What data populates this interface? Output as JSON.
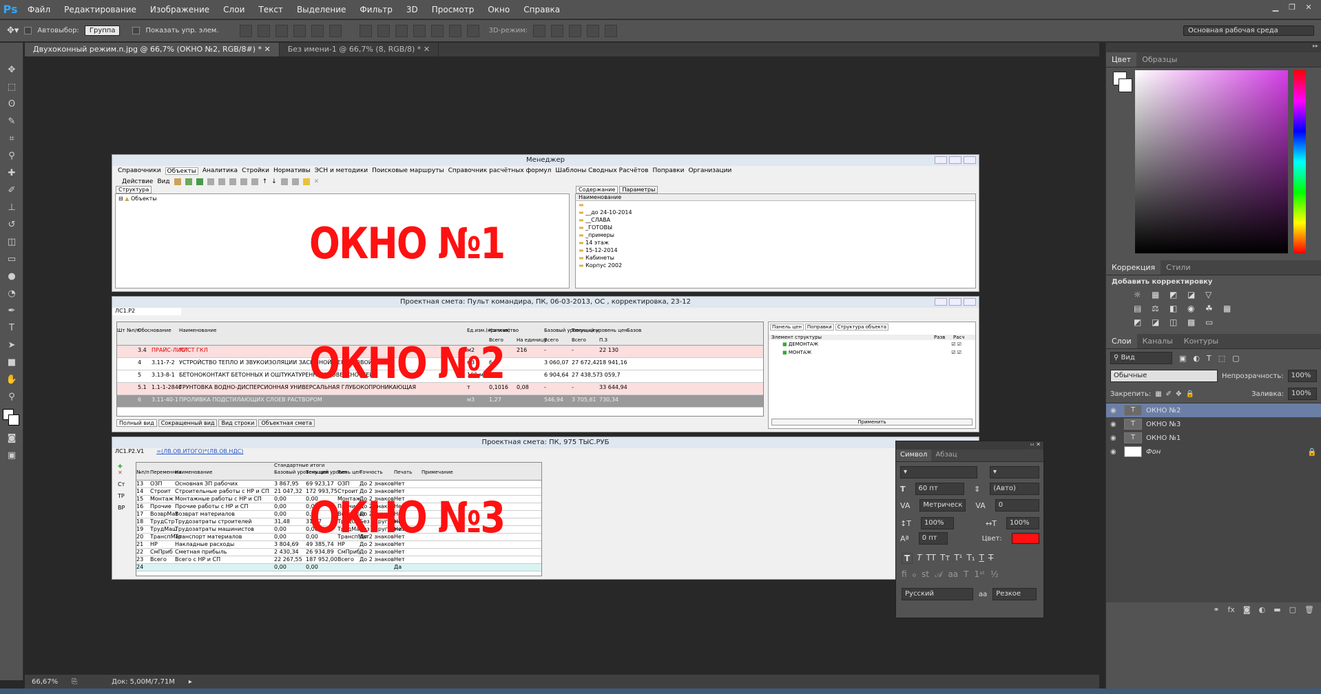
{
  "app": {
    "menu": [
      "Файл",
      "Редактирование",
      "Изображение",
      "Слои",
      "Текст",
      "Выделение",
      "Фильтр",
      "3D",
      "Просмотр",
      "Окно",
      "Справка"
    ]
  },
  "options": {
    "autoselect": "Автовыбор:",
    "group": "Группа",
    "show_controls": "Показать упр. элем.",
    "mode3d": "3D-режим:",
    "workspace": "Основная рабочая среда"
  },
  "tabs": [
    {
      "label": "Двухоконный режим.n.jpg @ 66,7% (ОКНО №2, RGB/8#) *"
    },
    {
      "label": "Без имени-1 @ 66,7% (8, RGB/8) *"
    }
  ],
  "status": {
    "zoom": "66,67%",
    "doc": "Док: 5,00M/7,71M"
  },
  "panels": {
    "color_tab": "Цвет",
    "swatches_tab": "Образцы",
    "adjust_tab": "Коррекция",
    "styles_tab": "Стили",
    "add_adjust": "Добавить корректировку",
    "layers_tab": "Слои",
    "channels_tab": "Каналы",
    "paths_tab": "Контуры",
    "kind": "Вид",
    "blend": "Обычные",
    "opacity_label": "Непрозрачность:",
    "opacity": "100%",
    "lock_label": "Закрепить:",
    "fill_label": "Заливка:",
    "fill": "100%"
  },
  "layers": [
    {
      "name": "ОКНО №2",
      "icon": "T"
    },
    {
      "name": "ОКНО №3",
      "icon": "T"
    },
    {
      "name": "ОКНО №1",
      "icon": "T"
    },
    {
      "name": "Фон",
      "icon": ""
    }
  ],
  "symbol": {
    "tab1": "Символ",
    "tab2": "Абзац",
    "size": "60 пт",
    "lead": "(Авто)",
    "kern": "Метрическ",
    "track": "0",
    "vscale": "100%",
    "hscale": "100%",
    "baseline": "0 пт",
    "color_label": "Цвет:",
    "lang": "Русский",
    "aa_label": "аа",
    "aa": "Резкое",
    "color": "#ff1111"
  },
  "win1": {
    "title": "Менеджер",
    "menu": [
      "Справочники",
      "Объекты",
      "Аналитика",
      "Стройки",
      "Нормативы",
      "ЭСН и методики",
      "Поисковые маршруты",
      "Справочник расчётных формул",
      "Шаблоны Сводных Расчётов",
      "Поправки",
      "Организации"
    ],
    "actions": [
      "Действие",
      "Вид"
    ],
    "left_tab": "Структура",
    "tree_root": "Объекты",
    "right_tabs": [
      "Содержание",
      "Параметры"
    ],
    "col": "Наименование",
    "folders": [
      "",
      "__до 24-10-2014",
      "__СЛАВА",
      "_ГОТОВЫ",
      "_примеры",
      "14 этаж",
      "15-12-2014",
      "Кабинеты",
      "Корпус 2002"
    ],
    "big": "ОКНО   №1"
  },
  "win2": {
    "title": "Проектная смета: Пульт командира, ПК, 06-03-2013, ОС , корректировка, 23-12",
    "field": "ЛС1.Р2",
    "headers": [
      "Шт",
      "№п/п",
      "Обоснование",
      "Наименование",
      "Ед.изм.(краткая)",
      "Количество",
      "Всего",
      "На единицу",
      "Базовый уровень цен",
      "Всего",
      "Текущий уровень цен",
      "Всего",
      "П.З",
      "Базов"
    ],
    "rows": [
      {
        "n": "3.4",
        "code": "ПРАЙС-ЛИСТ",
        "name": "ЛИСТ ГКЛ",
        "unit": "м2",
        "q": "270",
        "q1": "216",
        "b": "-",
        "t": "-",
        "t2": "22 130"
      },
      {
        "n": "4",
        "code": "3.11-7-2",
        "name": "УСТРОЙСТВО ТЕПЛО И ЗВУКОИЗОЛЯЦИИ ЗАСЫПНОЙ ПЕРЛИТОВОЙ",
        "unit": "м3",
        "q": "6,3",
        "q1": "",
        "b": "3 060,07",
        "t": "27 672,42",
        "t2": "18 941,16"
      },
      {
        "n": "5",
        "code": "3.13-8-1",
        "name": "БЕТОНОКОНТАКТ БЕТОННЫХ И ОШТУКАТУРЕННЫХ ПОВЕРХНОСТЕЙ",
        "unit": "100 м2",
        "q": "1,27",
        "q1": "",
        "b": "6 904,64",
        "t": "27 438,57",
        "t2": "3 059,7"
      },
      {
        "n": "5.1",
        "code": "1.1-1-2840",
        "name": "ГРУНТОВКА ВОДНО-ДИСПЕРСИОННАЯ УНИВЕРСАЛЬНАЯ ГЛУБОКОПРОНИКАЮЩАЯ",
        "unit": "т",
        "q": "0,1016",
        "q1": "0,08",
        "b": "-",
        "t": "-",
        "t2": "33 644,94"
      },
      {
        "n": "6",
        "code": "3.11-40-1",
        "name": "ПРОЛИВКА ПОДСТИЛАЮЩИХ СЛОЕВ РАСТВОРОМ",
        "unit": "м3",
        "q": "1,27",
        "q1": "",
        "b": "546,94",
        "t": "3 705,61",
        "t2": "730,34"
      }
    ],
    "bottom_tabs": [
      "Полный вид",
      "Сокращенный вид",
      "Вид строки",
      "Объектная смета"
    ],
    "right_tabs": [
      "Панель цен",
      "Поправки",
      "Структура объекта"
    ],
    "tree_col": "Элемент структуры",
    "tree_cols": [
      "Разв",
      "Расч"
    ],
    "tree_items": [
      "ДЕМОНТАЖ",
      "МОНТАЖ"
    ],
    "apply": "Применить",
    "big": "ОКНО   №2"
  },
  "win3": {
    "title": "Проектная смета: ПК, 975 ТЫС.РУБ",
    "field": "ЛС1.Р2.V1",
    "formula": "=(ЛВ.ОВ.ИТОГО)*(ЛВ.ОВ.НДС)",
    "side": [
      "Ст",
      "ТР",
      "ВР"
    ],
    "headers": [
      "№п/п",
      "Переменная",
      "Наименование",
      "Стандартные итоги",
      "Базовый уровень цен",
      "Текущий уровень цен",
      "Тип",
      "Точность",
      "Печать",
      "Примечание"
    ],
    "rows": [
      [
        "13",
        "ОЗП",
        "Основная ЗП рабочих",
        "3 867,95",
        "69 923,17",
        "ОЗП",
        "До 2 знаков",
        "Нет"
      ],
      [
        "14",
        "Строит",
        "Строительные работы с НР и СП",
        "21 047,32",
        "172 993,75",
        "Строит",
        "До 2 знаков",
        "Нет"
      ],
      [
        "15",
        "Монтаж",
        "Монтажные работы с НР и СП",
        "0,00",
        "0,00",
        "Монтаж",
        "До 2 знаков",
        "Нет"
      ],
      [
        "16",
        "Прочие",
        "Прочие работы с НР и СП",
        "0,00",
        "0,00",
        "Прочие",
        "До 2 знаков",
        "Нет"
      ],
      [
        "17",
        "ВозврМат",
        "Возврат материалов",
        "0,00",
        "0,00",
        "ВозврМат",
        "До 2 знаков",
        "Нет"
      ],
      [
        "18",
        "ТрудСтр",
        "Трудозатраты строителей",
        "31,48",
        "31,47",
        "ТрудСтр",
        "Без округления",
        "Нет"
      ],
      [
        "19",
        "ТрудМаш",
        "Трудозатраты машинистов",
        "0,00",
        "0,00",
        "ТрудМаш",
        "Без округления",
        "Нет"
      ],
      [
        "20",
        "ТранспМат",
        "Транспорт материалов",
        "0,00",
        "0,00",
        "ТранспМат",
        "До 2 знаков",
        "Нет"
      ],
      [
        "21",
        "НР",
        "Накладные расходы",
        "3 804,69",
        "49 385,74",
        "НР",
        "До 2 знаков",
        "Нет"
      ],
      [
        "22",
        "СмПриб",
        "Сметная прибыль",
        "2 430,34",
        "26 934,89",
        "СмПриб",
        "До 2 знаков",
        "Нет"
      ],
      [
        "23",
        "Всего",
        "Всего с НР и СП",
        "22 267,55",
        "187 952,00",
        "Всего",
        "До 2 знаков",
        "Нет"
      ],
      [
        "24",
        "",
        "",
        "0,00",
        "0,00",
        "",
        "",
        "Да"
      ]
    ],
    "big": "ОКНО  №3"
  }
}
